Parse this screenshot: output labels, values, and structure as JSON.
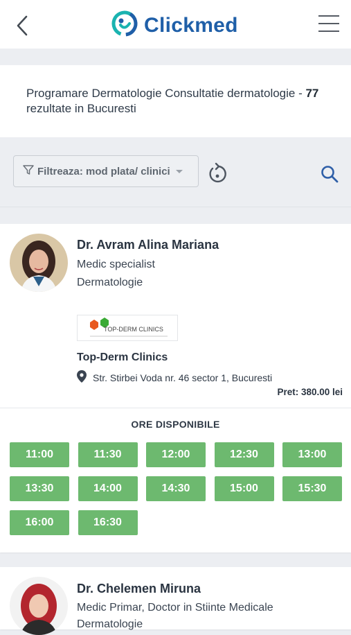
{
  "header": {
    "logo_text": "Clickmed"
  },
  "summary": {
    "prefix": "Programare Dermatologie Consultatie dermatologie - ",
    "count": "77",
    "suffix": " rezultate in Bucuresti"
  },
  "filter": {
    "label": "Filtreaza: mod plata/ clinici"
  },
  "doctors": [
    {
      "name": "Dr. Avram Alina Mariana",
      "title": "Medic specialist",
      "specialty": "Dermatologie",
      "clinic": {
        "logo_text": "TOP-DERM CLINICS",
        "name": "Top-Derm Clinics",
        "address": "Str. Stirbei Voda nr. 46 sector 1, Bucuresti"
      },
      "price": "Pret: 380.00 lei",
      "slots_title": "ORE DISPONIBILE",
      "slots": [
        "11:00",
        "11:30",
        "12:00",
        "12:30",
        "13:00",
        "13:30",
        "14:00",
        "14:30",
        "15:00",
        "15:30",
        "16:00",
        "16:30"
      ]
    },
    {
      "name": "Dr. Chelemen Miruna",
      "title": "Medic Primar, Doctor in Stiinte Medicale",
      "specialty": "Dermatologie"
    }
  ],
  "colors": {
    "brand_blue": "#1f5fa8",
    "brand_teal": "#1ab3b0",
    "slot_green": "#6db96f"
  },
  "icons": [
    "back-arrow-icon",
    "logo-icon",
    "hamburger-menu-icon",
    "filter-funnel-icon",
    "reset-icon",
    "search-icon",
    "location-pin-icon"
  ]
}
